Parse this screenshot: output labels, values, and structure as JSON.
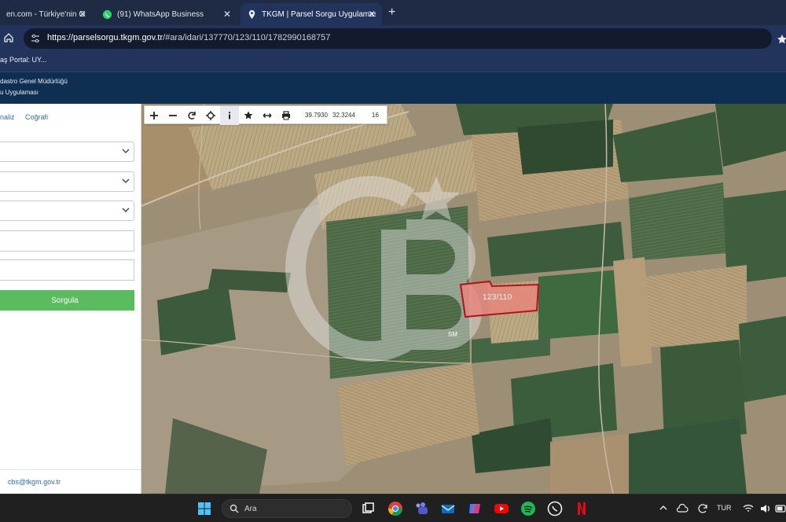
{
  "browser": {
    "tabs": [
      {
        "title": "en.com - Türkiye'nin O",
        "active": false
      },
      {
        "title": "(91) WhatsApp Business",
        "active": false
      },
      {
        "title": "TKGM | Parsel Sorgu Uygulamas",
        "active": true
      }
    ],
    "close_glyph": "✕",
    "new_tab_glyph": "+",
    "url_host": "https://parselsorgu.tkgm.gov.tr",
    "url_rest": "/#ara/idari/137770/123/110/1782990168757",
    "bookmark": "aş Portal: UY..."
  },
  "site": {
    "org_name": "dastro Genel Müdürlüğü",
    "app_name": "u Uygulaması"
  },
  "panel": {
    "tab_analiz": "naliz",
    "tab_cografi": "Coğrafi",
    "query_button": "Sorgula",
    "contact_email": "cbs@tkgm.gov.tr"
  },
  "map": {
    "coord_x": "39.7930",
    "coord_y": "32.3244",
    "zoom": "16",
    "parcel_label": "123/110",
    "watermark_mark": "SM",
    "colors": {
      "parcel_fill": "#e8857c",
      "parcel_stroke": "#b3121c",
      "field_dark": "#3f5a3b",
      "field_light": "#a89a7b"
    }
  },
  "taskbar": {
    "search_text": "Ara",
    "lang": "TUR"
  }
}
